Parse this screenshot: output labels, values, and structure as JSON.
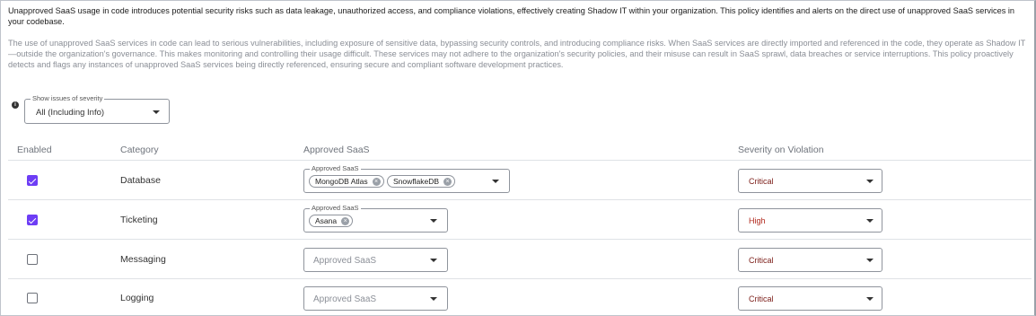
{
  "description": {
    "intro": "Unapproved SaaS usage in code introduces potential security risks such as data leakage, unauthorized access, and compliance violations, effectively creating Shadow IT within your organization. This policy identifies and alerts on the direct use of unapproved SaaS services in your codebase.",
    "detail": "The use of unapproved SaaS services in code can lead to serious vulnerabilities, including exposure of sensitive data, bypassing security controls, and introducing compliance risks. When SaaS services are directly imported and referenced in the code, they operate as Shadow IT—outside the organization's governance. This makes monitoring and controlling their usage difficult. These services may not adhere to the organization's security policies, and their misuse can result in SaaS sprawl, data breaches or service interruptions. This policy proactively detects and flags any instances of unapproved SaaS services being directly referenced, ensuring secure and compliant software development practices."
  },
  "filter": {
    "info_icon": "info-icon",
    "legend": "Show issues of severity",
    "value": "All (Including Info)"
  },
  "table": {
    "headers": {
      "enabled": "Enabled",
      "category": "Category",
      "approved_saas": "Approved SaaS",
      "severity": "Severity on Violation"
    },
    "rows": [
      {
        "enabled": true,
        "category": "Database",
        "saas_legend": "Approved SaaS",
        "chips": [
          "MongoDB Atlas",
          "SnowflakeDB"
        ],
        "placeholder": "",
        "severity": "Critical"
      },
      {
        "enabled": true,
        "category": "Ticketing",
        "saas_legend": "Approved SaaS",
        "chips": [
          "Asana"
        ],
        "placeholder": "",
        "severity": "High"
      },
      {
        "enabled": false,
        "category": "Messaging",
        "saas_legend": "",
        "chips": [],
        "placeholder": "Approved SaaS",
        "severity": "Critical"
      },
      {
        "enabled": false,
        "category": "Logging",
        "saas_legend": "",
        "chips": [],
        "placeholder": "Approved SaaS",
        "severity": "Critical"
      }
    ]
  },
  "colors": {
    "accent": "#6d3df5",
    "critical": "#7a1b16",
    "high": "#b0261a",
    "muted_text": "#8a8e96"
  }
}
